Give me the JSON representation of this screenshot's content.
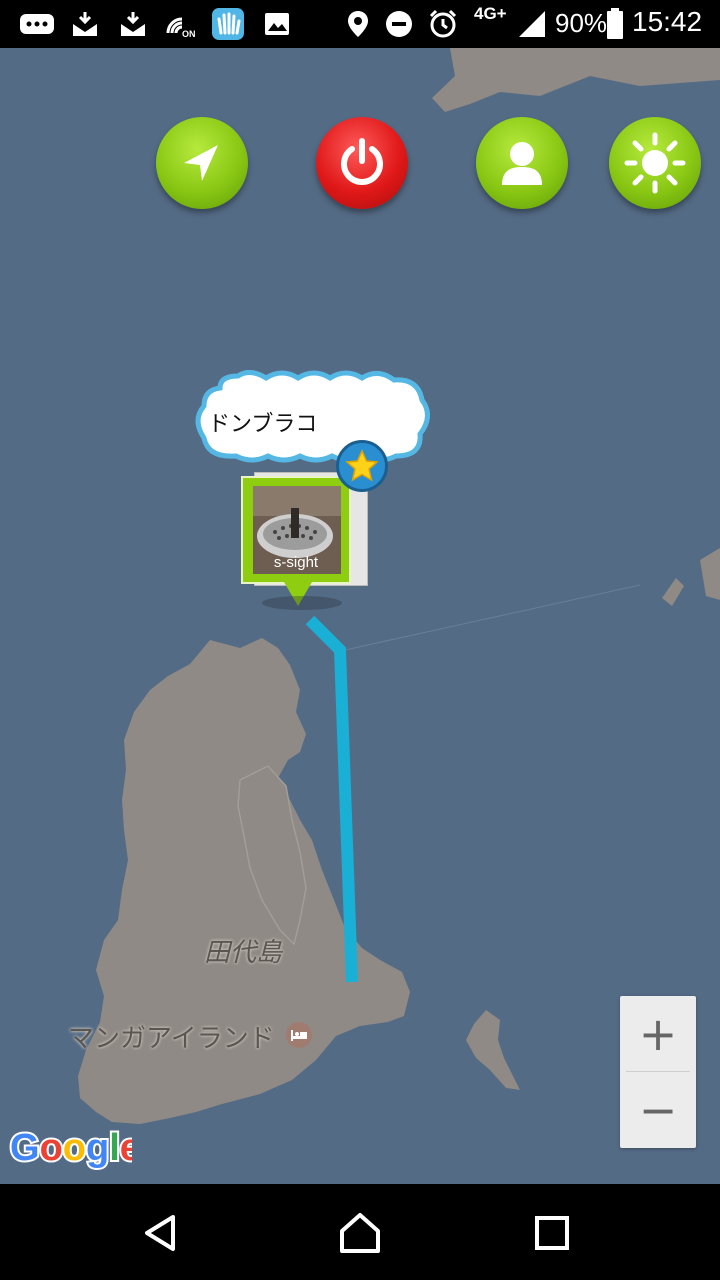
{
  "status_bar": {
    "network": "4G+",
    "battery": "90%",
    "time": "15:42",
    "icons": [
      "message-icon",
      "mail-download-icon",
      "mail-download-icon",
      "nfc-icon",
      "hi-app-icon",
      "image-icon",
      "location-icon",
      "do-not-disturb-icon",
      "alarm-icon",
      "signal-icon",
      "battery-icon"
    ]
  },
  "toolbar": {
    "buttons": [
      "navigate-button",
      "power-button",
      "profile-button",
      "brightness-button"
    ],
    "colors": {
      "green": "#8cc716",
      "red": "#e01818"
    }
  },
  "map": {
    "water_color": "#546b85",
    "land_color": "#8f8a85",
    "route_color": "#1aafd4",
    "labels": {
      "island": "田代島",
      "place": "マンガアイランド"
    },
    "attribution": "Google"
  },
  "marker": {
    "name": "ドンブラコ",
    "photo_label": "s-sight",
    "favorite_icon": "star-icon"
  },
  "zoom": {
    "in": "+",
    "out": "−"
  },
  "nav_bar": {
    "buttons": [
      "back-button",
      "home-button",
      "recents-button"
    ]
  }
}
